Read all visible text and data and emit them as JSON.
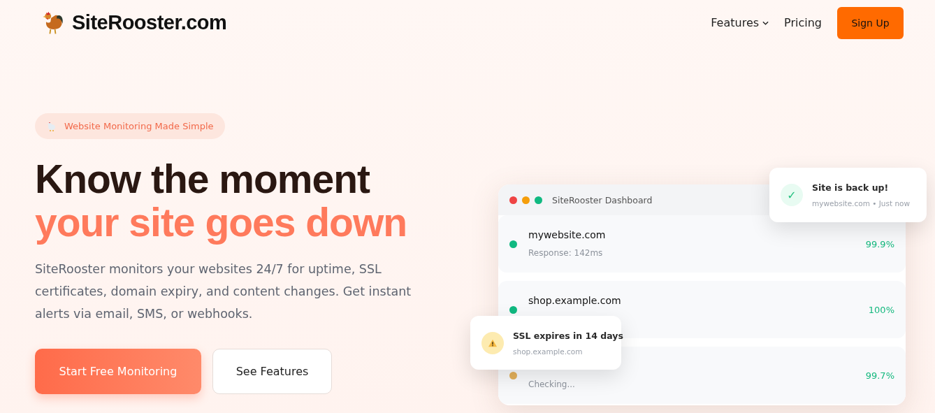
{
  "brand": {
    "name": "SiteRooster.com"
  },
  "nav": [
    {
      "label": "Features",
      "dropdown": true
    },
    {
      "label": "Pricing",
      "dropdown": false
    }
  ],
  "signup": {
    "label": "Sign Up"
  },
  "hero": {
    "badge": "Website Monitoring Made Simple",
    "title_line1": "Know the moment",
    "title_line2": "your site goes down",
    "description": "SiteRooster monitors your websites 24/7 for uptime, SSL certificates, domain expiry, and content changes. Get instant alerts via email, SMS, or webhooks.",
    "buttons": [
      {
        "label": "Start Free Monitoring",
        "kind": "primary"
      },
      {
        "label": "See Features",
        "kind": "secondary"
      }
    ]
  },
  "dashboard": {
    "title": "SiteRooster Dashboard",
    "rows": [
      {
        "name": "mywebsite.com",
        "detail": "Response: 142ms",
        "uptime": "99.9%",
        "color": "#10b981"
      },
      {
        "name": "shop.example.com",
        "uptime": "100%",
        "color": "#10b981"
      },
      {
        "detail": "Checking...",
        "uptime": "99.7%",
        "color": "#e3b05a"
      }
    ]
  },
  "toasts": [
    {
      "kind": "success",
      "icon": "✓",
      "title": "Site is back up!",
      "detail": "mywebsite.com • Just now"
    },
    {
      "kind": "warning",
      "title": "SSL expires in 14 days",
      "detail": "shop.example.com"
    }
  ]
}
